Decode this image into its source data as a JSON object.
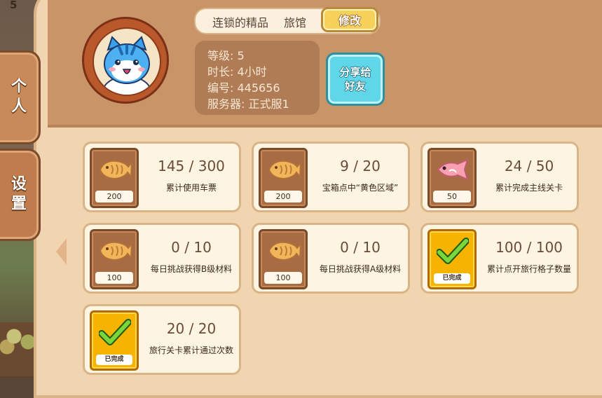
{
  "side": {
    "level_badge": "5",
    "tabs": [
      {
        "label": "个人"
      },
      {
        "label": "设置"
      }
    ]
  },
  "profile": {
    "name": "连锁的精品",
    "title": "旅馆",
    "edit_label": "修改",
    "share_label": "分享给好友",
    "info": {
      "level": "等级: 5",
      "duration": "时长: 4小时",
      "id": "编号: 445656",
      "server": "服务器: 正式服1"
    }
  },
  "tasks": [
    {
      "reward_icon": "taiyaki-icon",
      "reward_count": "200",
      "progress": "145 / 300",
      "description": "累计使用车票",
      "completed": false
    },
    {
      "reward_icon": "taiyaki-icon",
      "reward_count": "200",
      "progress": "9 / 20",
      "description": "宝箱点中“黄色区域”",
      "completed": false
    },
    {
      "reward_icon": "fish-icon",
      "reward_count": "50",
      "progress": "24 / 50",
      "description": "累计完成主线关卡",
      "completed": false
    },
    {
      "reward_icon": "taiyaki-icon",
      "reward_count": "100",
      "progress": "0 / 10",
      "description": "每日挑战获得B级材料",
      "completed": false
    },
    {
      "reward_icon": "taiyaki-icon",
      "reward_count": "100",
      "progress": "0 / 10",
      "description": "每日挑战获得A级材料",
      "completed": false
    },
    {
      "reward_icon": "checkmark-icon",
      "reward_count": "已完成",
      "progress": "100 / 100",
      "description": "累计点开旅行格子数量",
      "completed": true
    },
    {
      "reward_icon": "checkmark-icon",
      "reward_count": "已完成",
      "progress": "20 / 20",
      "description": "旅行关卡累计通过次数",
      "completed": true
    }
  ],
  "colors": {
    "panel": "#f1d4b0",
    "header": "#c89468",
    "edit_button": "#f6d25a",
    "share_button": "#5fd7e8",
    "complete_badge": "#f6b400"
  }
}
